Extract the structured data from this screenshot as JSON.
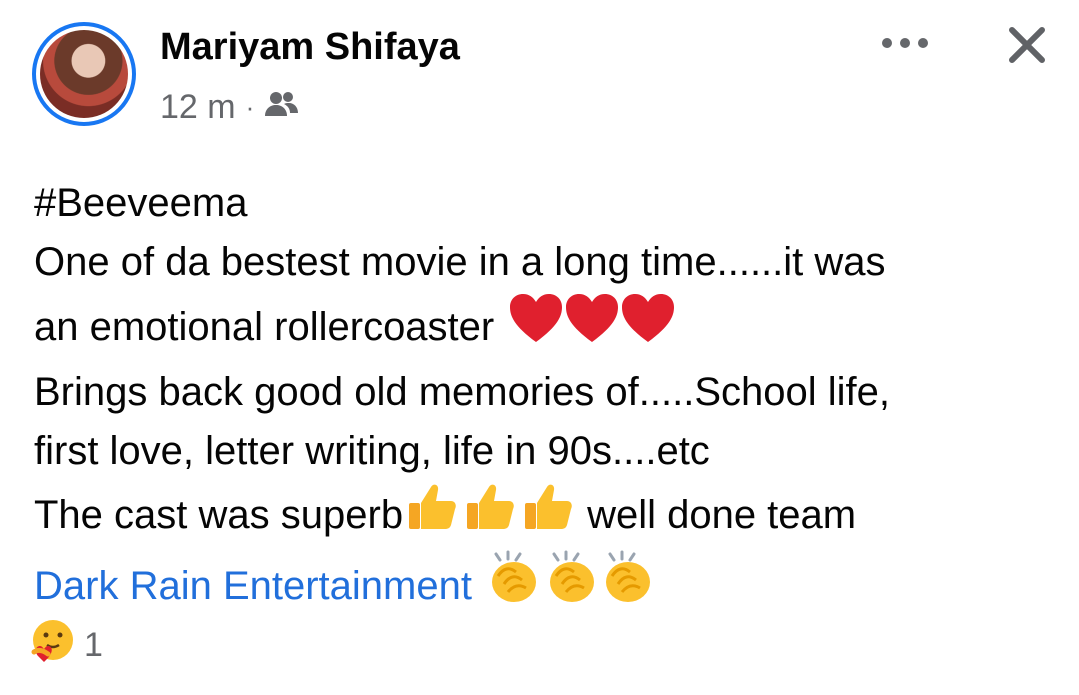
{
  "header": {
    "author_name": "Mariyam Shifaya",
    "timestamp": "12 m",
    "separator": "·",
    "audience_icon": "friends-icon",
    "more_icon": "more-options-icon",
    "close_icon": "close-icon"
  },
  "post": {
    "hashtag": "#Beeveema",
    "line1": "One of da bestest movie in a long time......it was",
    "line2": "an emotional rollercoaster",
    "line3": "Brings back good old memories of.....School life,",
    "line4": "first love, letter writing, life in 90s....etc",
    "line5a": "The cast was superb",
    "line5b": "well done team",
    "mention": "Dark Rain Entertainment",
    "emoji": {
      "heart": "red-heart",
      "thumbs_up": "thumbs-up",
      "clap": "clapping-hands"
    }
  },
  "reactions": {
    "icon": "care-reaction-icon",
    "count": "1"
  },
  "colors": {
    "accent": "#1877f2",
    "link": "#216fdb",
    "secondary_text": "#65676b",
    "heart": "#e0202e",
    "emoji_yellow": "#fbc02d"
  }
}
